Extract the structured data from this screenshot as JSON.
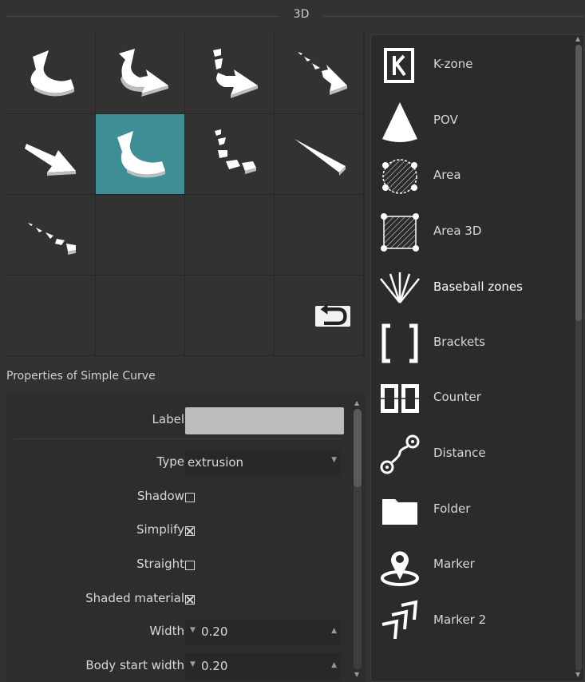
{
  "header": {
    "title": "3D"
  },
  "properties": {
    "title": "Properties of Simple Curve",
    "label_label": "Label",
    "label_value": "",
    "type_label": "Type",
    "type_value": "extrusion",
    "shadow_label": "Shadow",
    "shadow_checked": false,
    "simplify_label": "Simplify",
    "simplify_checked": true,
    "straight_label": "Straight",
    "straight_checked": false,
    "shaded_label": "Shaded material",
    "shaded_checked": true,
    "width_label": "Width",
    "width_value": "0.20",
    "body_start_width_label": "Body start width",
    "body_start_width_value": "0.20"
  },
  "objects": [
    {
      "label": "K-zone",
      "icon": "kzone-icon"
    },
    {
      "label": "POV",
      "icon": "pov-cone-icon"
    },
    {
      "label": "Area",
      "icon": "area-circle-icon"
    },
    {
      "label": "Area 3D",
      "icon": "area-3d-square-icon"
    },
    {
      "label": "Baseball zones",
      "icon": "baseball-zones-icon"
    },
    {
      "label": "Brackets",
      "icon": "brackets-icon"
    },
    {
      "label": "Counter",
      "icon": "counter-icon"
    },
    {
      "label": "Distance",
      "icon": "distance-icon"
    },
    {
      "label": "Folder",
      "icon": "folder-icon"
    },
    {
      "label": "Marker",
      "icon": "marker-pin-icon"
    },
    {
      "label": "Marker 2",
      "icon": "marker-2-icon"
    }
  ],
  "selected_shape_index": 5,
  "colors": {
    "accent": "#3d8f95",
    "background": "#323232",
    "panel": "#2b2b2b"
  }
}
